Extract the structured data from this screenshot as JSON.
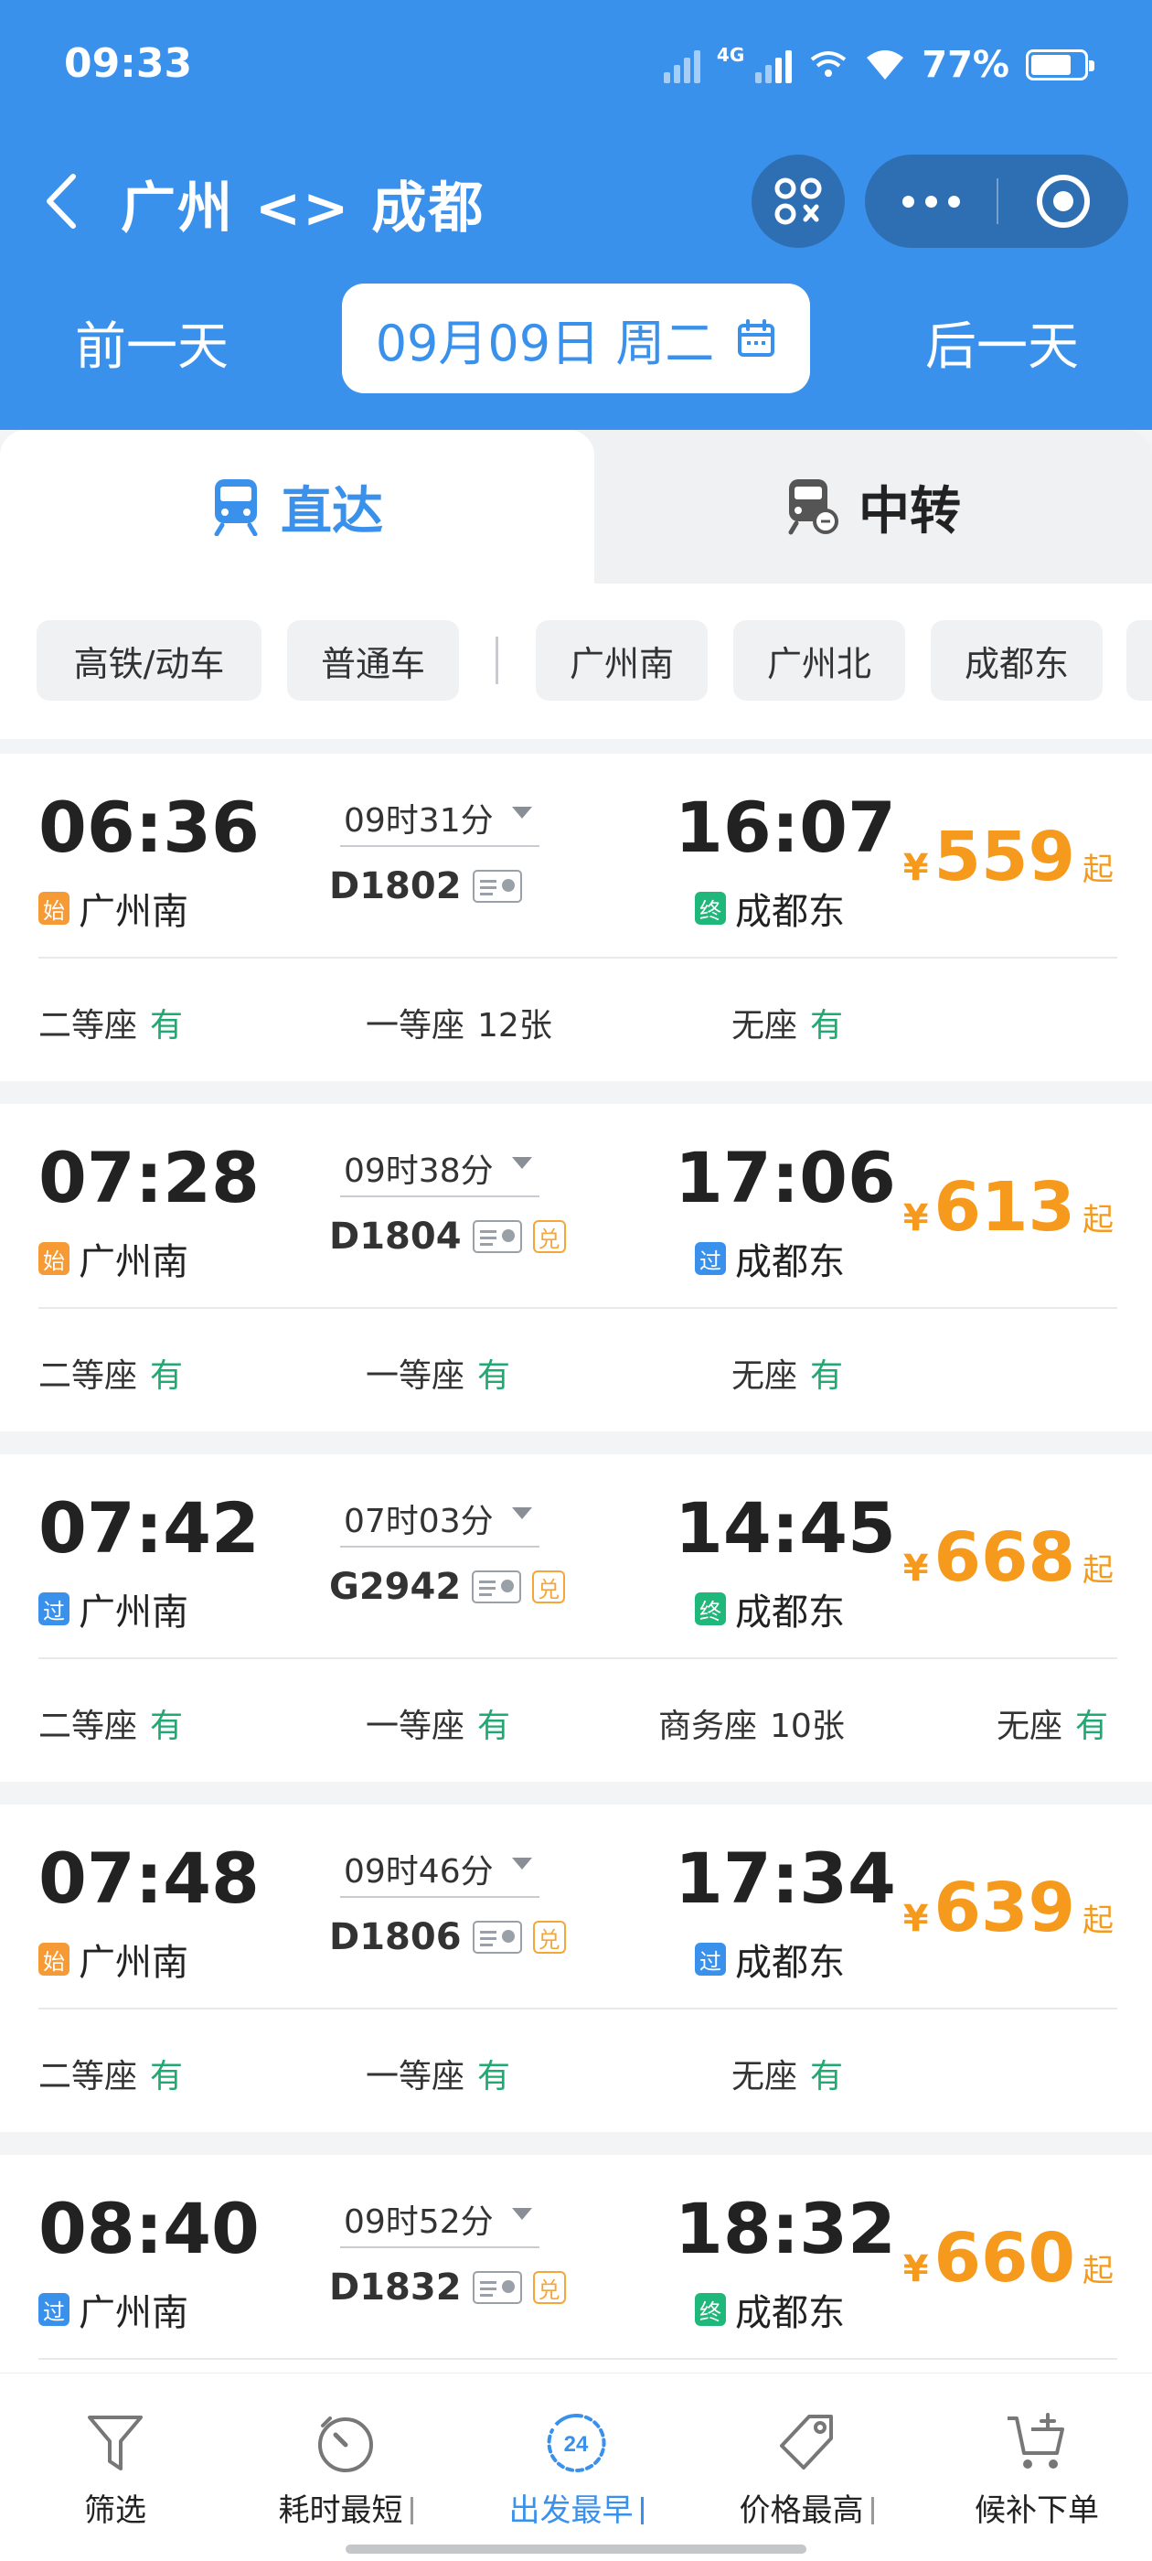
{
  "status_bar": {
    "time": "09:33",
    "network": "4G",
    "battery": "77%",
    "battery_level": 0.77
  },
  "nav": {
    "title": "广州 <> 成都",
    "icons": [
      "back-icon",
      "scan-icon",
      "more-icon",
      "close-miniprogram-icon"
    ]
  },
  "date_bar": {
    "prev_label": "前一天",
    "date_label": "09月09日 周二",
    "next_label": "后一天",
    "calendar_icon": "calendar-icon"
  },
  "tabs": [
    {
      "label": "直达",
      "icon": "train-icon",
      "active": true
    },
    {
      "label": "中转",
      "icon": "transfer-train-icon",
      "active": false
    }
  ],
  "filters": {
    "type_chips": [
      "高铁/动车",
      "普通车"
    ],
    "station_chips": [
      "广州南",
      "广州北",
      "成都东"
    ]
  },
  "trains": [
    {
      "dep_time": "06:36",
      "dep_station": "广州南",
      "dep_badge": "始",
      "duration": "09时31分",
      "train_no": "D1802",
      "has_exchange": false,
      "arr_time": "16:07",
      "arr_station": "成都东",
      "arr_badge": "终",
      "price_symbol": "¥",
      "price": "559",
      "price_suffix": "起",
      "seats": [
        {
          "name": "二等座",
          "status": "有"
        },
        {
          "name": "一等座",
          "status": "12张"
        },
        {
          "name": "无座",
          "status": "有"
        }
      ]
    },
    {
      "dep_time": "07:28",
      "dep_station": "广州南",
      "dep_badge": "始",
      "duration": "09时38分",
      "train_no": "D1804",
      "has_exchange": true,
      "arr_time": "17:06",
      "arr_station": "成都东",
      "arr_badge": "过",
      "price_symbol": "¥",
      "price": "613",
      "price_suffix": "起",
      "seats": [
        {
          "name": "二等座",
          "status": "有"
        },
        {
          "name": "一等座",
          "status": "有"
        },
        {
          "name": "无座",
          "status": "有"
        }
      ]
    },
    {
      "dep_time": "07:42",
      "dep_station": "广州南",
      "dep_badge": "过",
      "duration": "07时03分",
      "train_no": "G2942",
      "has_exchange": true,
      "arr_time": "14:45",
      "arr_station": "成都东",
      "arr_badge": "终",
      "price_symbol": "¥",
      "price": "668",
      "price_suffix": "起",
      "seats": [
        {
          "name": "二等座",
          "status": "有"
        },
        {
          "name": "一等座",
          "status": "有"
        },
        {
          "name": "商务座",
          "status": "10张"
        },
        {
          "name": "无座",
          "status": "有"
        }
      ]
    },
    {
      "dep_time": "07:48",
      "dep_station": "广州南",
      "dep_badge": "始",
      "duration": "09时46分",
      "train_no": "D1806",
      "has_exchange": true,
      "arr_time": "17:34",
      "arr_station": "成都东",
      "arr_badge": "过",
      "price_symbol": "¥",
      "price": "639",
      "price_suffix": "起",
      "seats": [
        {
          "name": "二等座",
          "status": "有"
        },
        {
          "name": "一等座",
          "status": "有"
        },
        {
          "name": "无座",
          "status": "有"
        }
      ]
    },
    {
      "dep_time": "08:40",
      "dep_station": "广州南",
      "dep_badge": "过",
      "duration": "09时52分",
      "train_no": "D1832",
      "has_exchange": true,
      "arr_time": "18:32",
      "arr_station": "成都东",
      "arr_badge": "终",
      "price_symbol": "¥",
      "price": "660",
      "price_suffix": "起",
      "seats": []
    }
  ],
  "id_icon": "id-card-icon",
  "exchange_badge": "兑",
  "bottom_bar": [
    {
      "label": "筛选",
      "icon": "filter-icon",
      "active": false
    },
    {
      "label": "耗时最短",
      "icon": "timer-icon",
      "active": false
    },
    {
      "label": "出发最早",
      "icon": "24h-icon",
      "icon_text": "24",
      "active": true
    },
    {
      "label": "价格最高",
      "icon": "price-tag-icon",
      "active": false
    },
    {
      "label": "候补下单",
      "icon": "cart-add-icon",
      "active": false
    }
  ],
  "colors": {
    "primary": "#3a91ec",
    "price": "#f59a1d",
    "available": "#20a971",
    "badge_origin": "#f59a34",
    "badge_pass": "#3a91ec",
    "badge_terminal": "#20b77a"
  }
}
